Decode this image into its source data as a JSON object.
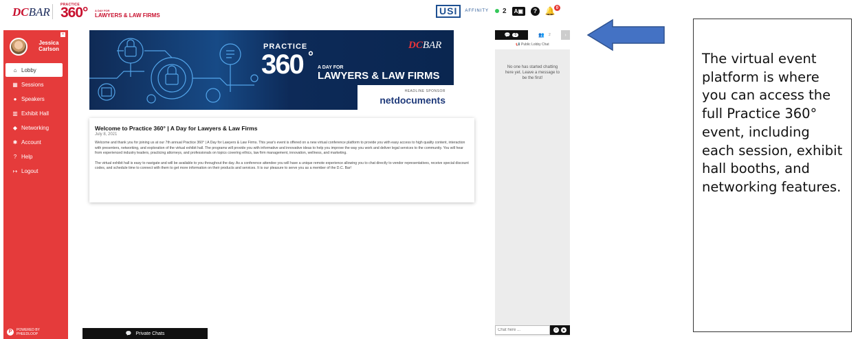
{
  "header": {
    "dcbar_logo": {
      "dc": "DC",
      "bar": "BAR"
    },
    "p360_logo": {
      "small": "PRACTICE",
      "big": "360°",
      "dayfor": "A DAY FOR",
      "law": "LAWYERS & LAW FIRMS"
    },
    "sponsor_logo": {
      "name": "USI",
      "tag": "AFFINITY"
    },
    "online_count": "2",
    "az_label": "A▣",
    "notification_count": "0"
  },
  "user": {
    "name": "Jessica Carlson"
  },
  "sidebar": {
    "collapse_label": "«",
    "items": [
      {
        "icon": "⌂",
        "label": "Lobby",
        "active": true
      },
      {
        "icon": "▦",
        "label": "Sessions"
      },
      {
        "icon": "●",
        "label": "Speakers"
      },
      {
        "icon": "▥",
        "label": "Exhibit Hall"
      },
      {
        "icon": "◆",
        "label": "Networking"
      },
      {
        "icon": "✱",
        "label": "Account"
      },
      {
        "icon": "?",
        "label": "Help"
      },
      {
        "icon": "↦",
        "label": "Logout"
      }
    ],
    "powered_by": {
      "line1": "POWERED BY",
      "line2": "PHEEDLOOP"
    }
  },
  "banner": {
    "practice": "PRACTICE",
    "num": "360",
    "deg": "°",
    "dayfor": "A DAY FOR",
    "law": "LAWYERS & LAW FIRMS",
    "dcbar": {
      "dc": "DC",
      "bar": "BAR"
    },
    "headline_sponsor": "HEADLINE SPONSOR",
    "sponsor_name": "netdocuments"
  },
  "welcome": {
    "title": "Welcome to Practice 360° | A Day for Lawyers & Law Firms",
    "date": "July 8, 2021",
    "para1": "Welcome and thank you for joining us at our 7th annual Practice 360° | A Day for Lawyers & Law Firms. This year's event is offered on a new virtual conference platform to provide you with easy access to high quality content, interaction with presenters, networking, and exploration of the virtual exhibit hall. The programs will provide you with informative and innovative ideas to help you improve the way you work and deliver legal services to the community. You will hear from experienced industry leaders, practicing attorneys, and professionals on topics covering ethics, law firm management, innovation, wellness, and marketing.",
    "para2": "The virtual exhibit hall is easy to navigate and will be available to you throughout the day. As a conference attendee you will have a unique remote experience allowing you to chat directly to vendor representatives, receive special discount codes, and schedule time to connect with them to get more information on their products and services. It is our pleasure to serve you as a member of the D.C. Bar!"
  },
  "chat": {
    "tab_chat_count": "0",
    "tab_people_count": "2",
    "lobby_label": "Public Lobby Chat",
    "empty_message": "No one has started chatting here yet. Leave a message to be the first!",
    "input_placeholder": "Chat here ..."
  },
  "private_chats": {
    "label": "Private Chats"
  },
  "annotation": {
    "text": "The virtual event platform is where you can access the full Practice 360° event, including each session, exhibit hall booths, and networking features.",
    "arrow_color": "#4472c4"
  }
}
